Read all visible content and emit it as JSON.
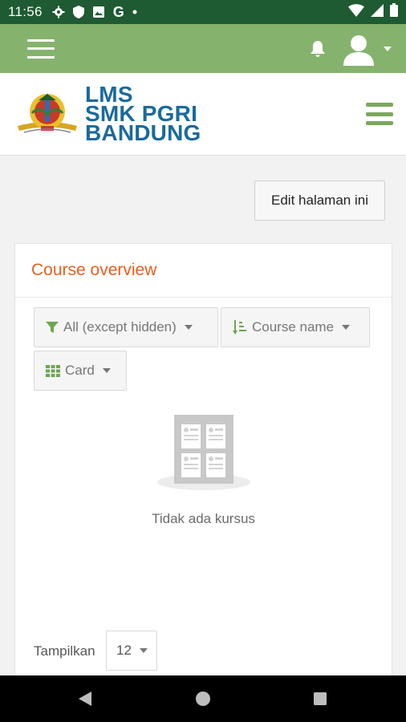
{
  "status_bar": {
    "time": "11:56",
    "icons": [
      "gear-icon",
      "shield-icon",
      "image-icon",
      "google-g-icon",
      "dot-icon",
      "wifi-icon",
      "cell-signal-icon",
      "battery-icon"
    ],
    "google_letter": "G"
  },
  "navbar": {
    "background": "#85b36d",
    "icons": [
      "hamburger-menu-icon",
      "bell-icon",
      "user-avatar-icon",
      "caret-down-icon"
    ]
  },
  "site": {
    "logo_lines": [
      "LMS",
      "SMK PGRI",
      "BANDUNG"
    ],
    "brand_color": "#1a6a9c"
  },
  "page": {
    "edit_button": "Edit halaman ini"
  },
  "course_overview": {
    "title": "Course overview",
    "title_color": "#e6601f",
    "filter_label": "All (except hidden)",
    "sort_label": "Course name",
    "view_label": "Card",
    "empty_message": "Tidak ada kursus",
    "show_label": "Tampilkan",
    "show_value": "12"
  },
  "system_nav": {
    "icons": [
      "back-icon",
      "home-icon",
      "recents-icon"
    ]
  }
}
